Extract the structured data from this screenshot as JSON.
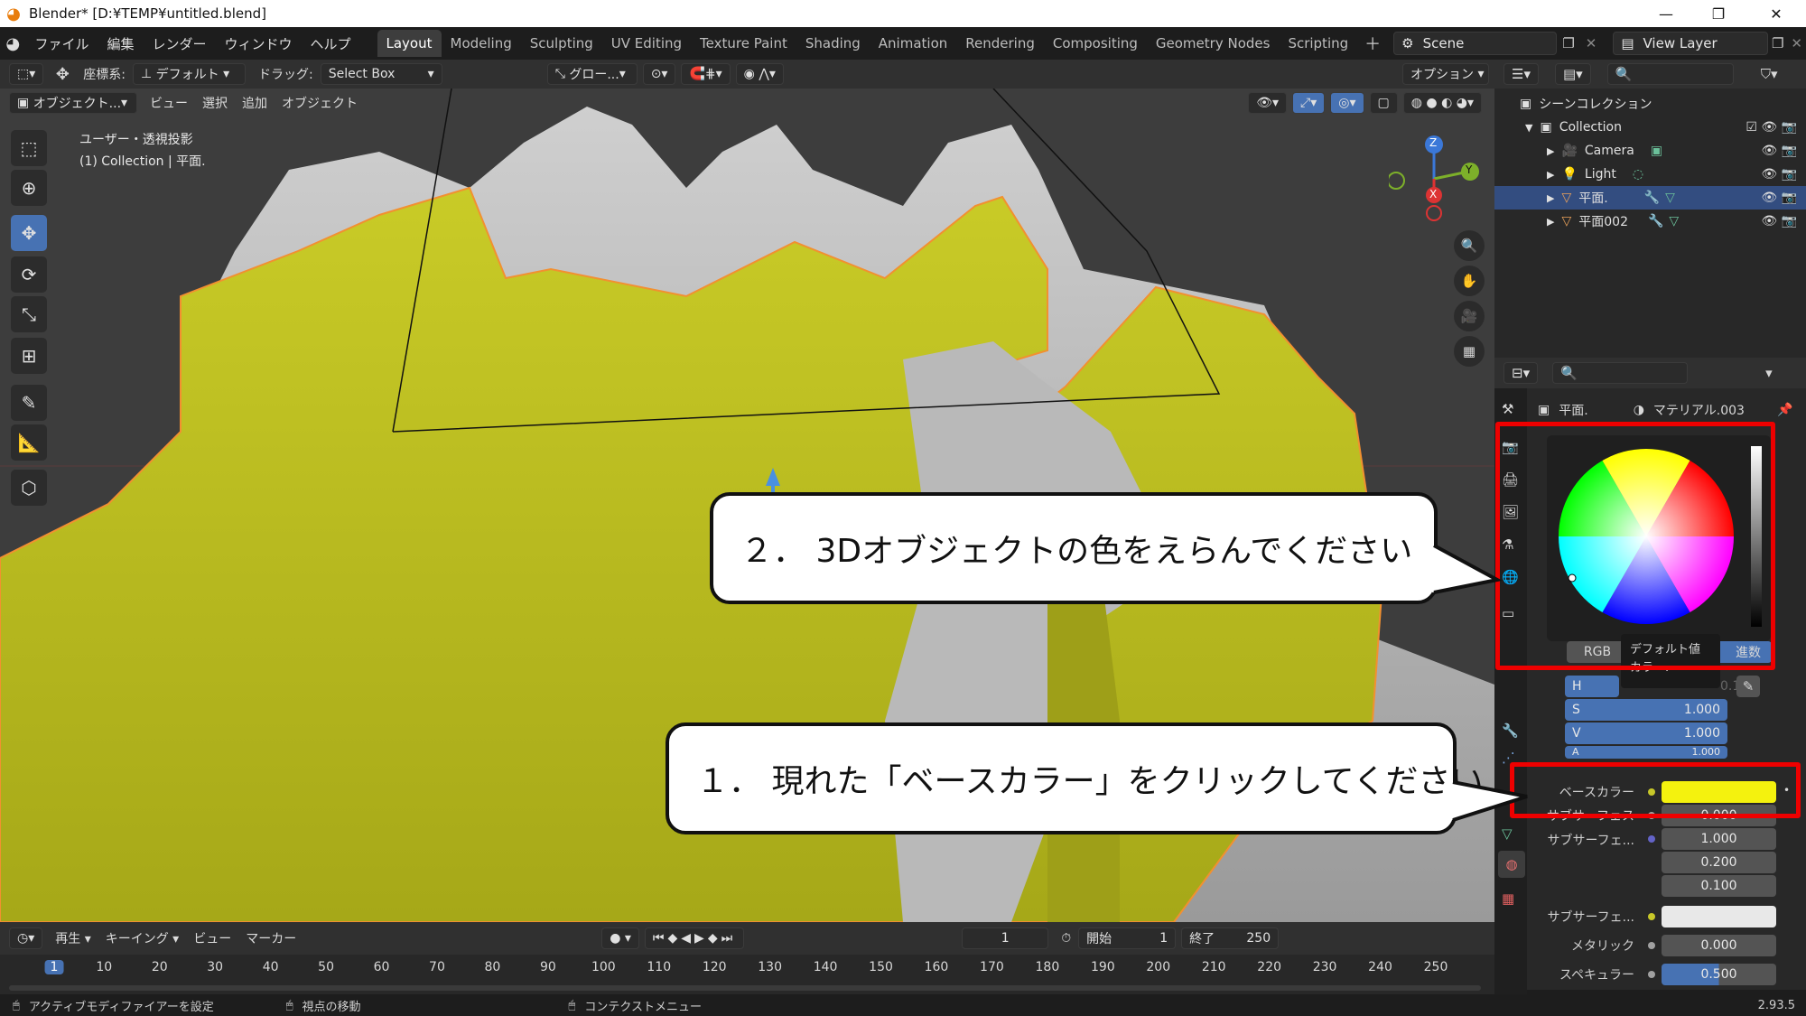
{
  "window": {
    "title": "Blender* [D:¥TEMP¥untitled.blend]",
    "min": "—",
    "max": "❐",
    "close": "✕"
  },
  "menus": [
    "ファイル",
    "編集",
    "レンダー",
    "ウィンドウ",
    "ヘルプ"
  ],
  "workspace_tabs": [
    "Layout",
    "Modeling",
    "Sculpting",
    "UV Editing",
    "Texture Paint",
    "Shading",
    "Animation",
    "Rendering",
    "Compositing",
    "Geometry Nodes",
    "Scripting"
  ],
  "active_tab": "Layout",
  "scene": "Scene",
  "view_layer": "View Layer",
  "header2": {
    "coord_label": "座標系:",
    "coord_value": "デフォルト",
    "drag_label": "ドラッグ:",
    "drag_value": "Select Box",
    "pivot_value": "グロー...",
    "options": "オプション"
  },
  "viewport_header": {
    "mode": "オブジェクト...",
    "view": "ビュー",
    "select": "選択",
    "add": "追加",
    "object": "オブジェクト"
  },
  "viewport_info": {
    "line1": "ユーザー・透視投影",
    "line2": "(1) Collection | 平面."
  },
  "gizmo": {
    "z": "Z",
    "y": "Y",
    "x": "X"
  },
  "outliner": {
    "root": "シーンコレクション",
    "items": [
      {
        "name": "Collection",
        "icon": "collection-icon"
      },
      {
        "name": "Camera",
        "icon": "camera-icon"
      },
      {
        "name": "Light",
        "icon": "light-icon"
      },
      {
        "name": "平面.",
        "icon": "mesh-icon",
        "selected": true
      },
      {
        "name": "平面002",
        "icon": "mesh-icon"
      }
    ]
  },
  "properties": {
    "object_name": "平面.",
    "material_name": "マテリアル.003",
    "color_picker": {
      "mode_rgb": "RGB",
      "mode_hex": "進数",
      "tooltip_line1": "デフォルト値",
      "tooltip_line2": "カラー.",
      "h_label": "H",
      "h_value": "0.167",
      "s_label": "S",
      "s_value": "1.000",
      "v_label": "V",
      "v_value": "1.000",
      "a_label": "A",
      "a_value": "1.000"
    },
    "rows": [
      {
        "label": "ベースカラー",
        "type": "color",
        "color": "#f4f20e"
      },
      {
        "label": "サブサーフェス",
        "type": "value",
        "value": "0.000"
      },
      {
        "label": "サブサーフェ...",
        "type": "vector",
        "values": [
          "1.000",
          "0.200",
          "0.100"
        ]
      },
      {
        "label": "サブサーフェ...",
        "type": "color",
        "color": "#e8e8e8"
      },
      {
        "label": "メタリック",
        "type": "value",
        "value": "0.000"
      },
      {
        "label": "スペキュラー",
        "type": "value",
        "value": "0.500"
      }
    ]
  },
  "timeline": {
    "playback": "再生",
    "keying": "キーイング",
    "view": "ビュー",
    "marker": "マーカー",
    "current_frame": "1",
    "start_label": "開始",
    "start": "1",
    "end_label": "終了",
    "end": "250",
    "ticks": [
      "1",
      "10",
      "20",
      "30",
      "40",
      "50",
      "60",
      "70",
      "80",
      "90",
      "100",
      "110",
      "120",
      "130",
      "140",
      "150",
      "160",
      "170",
      "180",
      "190",
      "200",
      "210",
      "220",
      "230",
      "240",
      "250"
    ]
  },
  "statusbar": {
    "left": "アクティブモディファイアーを設定",
    "middle": "視点の移動",
    "right": "コンテクストメニュー",
    "version": "2.93.5"
  },
  "callouts": {
    "step1": "１．  現れた「ベースカラー」をクリックしてください",
    "step2": "２．  3Dオブジェクトの色をえらんでください"
  },
  "colors": {
    "accent": "#4772b3",
    "highlight": "#ee0000",
    "object_yellow": "#c8c81e",
    "base_color": "#f4f20e",
    "selected_row": "#334d80"
  }
}
